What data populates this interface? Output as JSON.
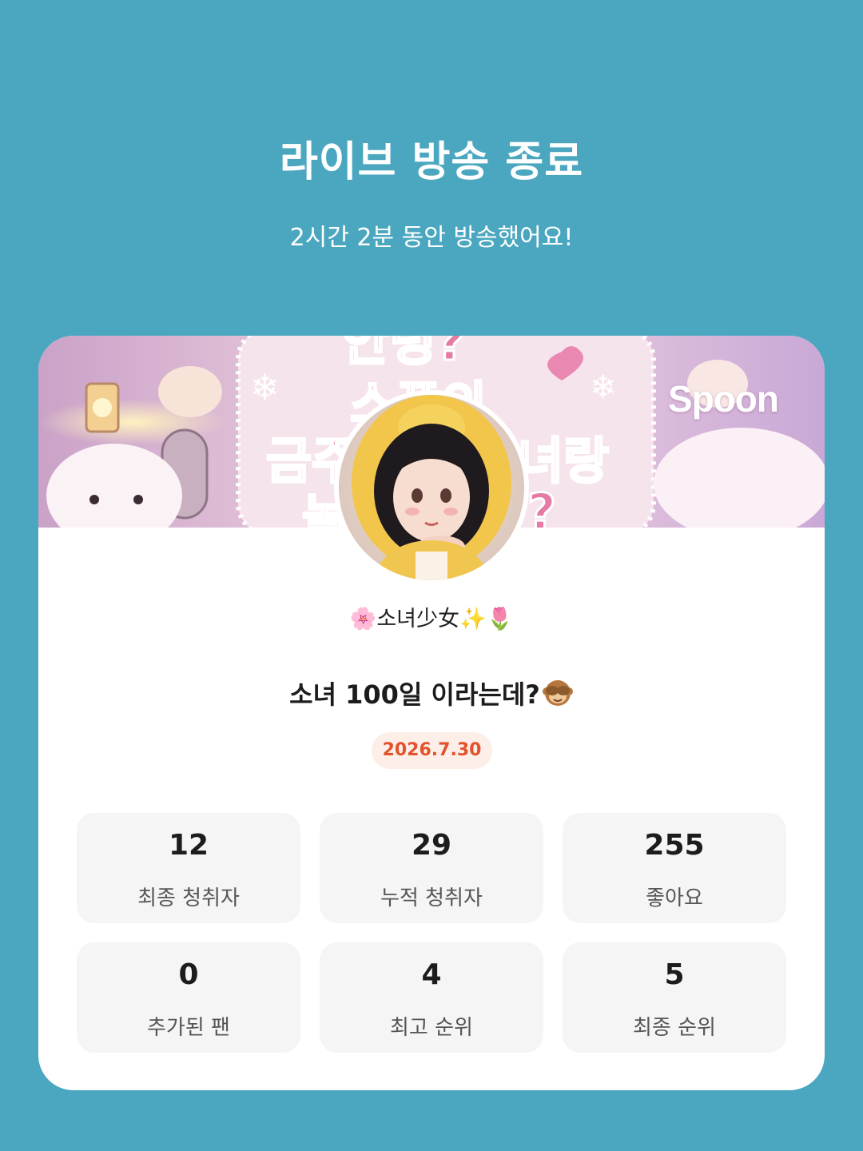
{
  "header": {
    "title": "라이브 방송 종료",
    "subtitle": "2시간 2분 동안 방송했어요!"
  },
  "card": {
    "brand": "Spoon",
    "banner_text_fragments": [
      "안녕?",
      "스푼의",
      "금주",
      "녀랑",
      "놀",
      "?"
    ],
    "username": {
      "prefix_emoji": "🌸",
      "name": "소녀少女",
      "suffix_decor": "✨🌷"
    },
    "live_title": "소녀 100일 이라는데?",
    "live_title_emoji": "see-no-evil-monkey-icon",
    "date": "2026.7.30",
    "colors": {
      "background": "#4ba7bf",
      "date_pill_bg": "#fdeee8",
      "date_pill_text": "#e2532d",
      "stat_box_bg": "#f5f5f5"
    },
    "stats": [
      {
        "value": "12",
        "label": "최종 청취자"
      },
      {
        "value": "29",
        "label": "누적 청취자"
      },
      {
        "value": "255",
        "label": "좋아요"
      },
      {
        "value": "0",
        "label": "추가된 팬"
      },
      {
        "value": "4",
        "label": "최고 순위"
      },
      {
        "value": "5",
        "label": "최종 순위"
      }
    ]
  }
}
